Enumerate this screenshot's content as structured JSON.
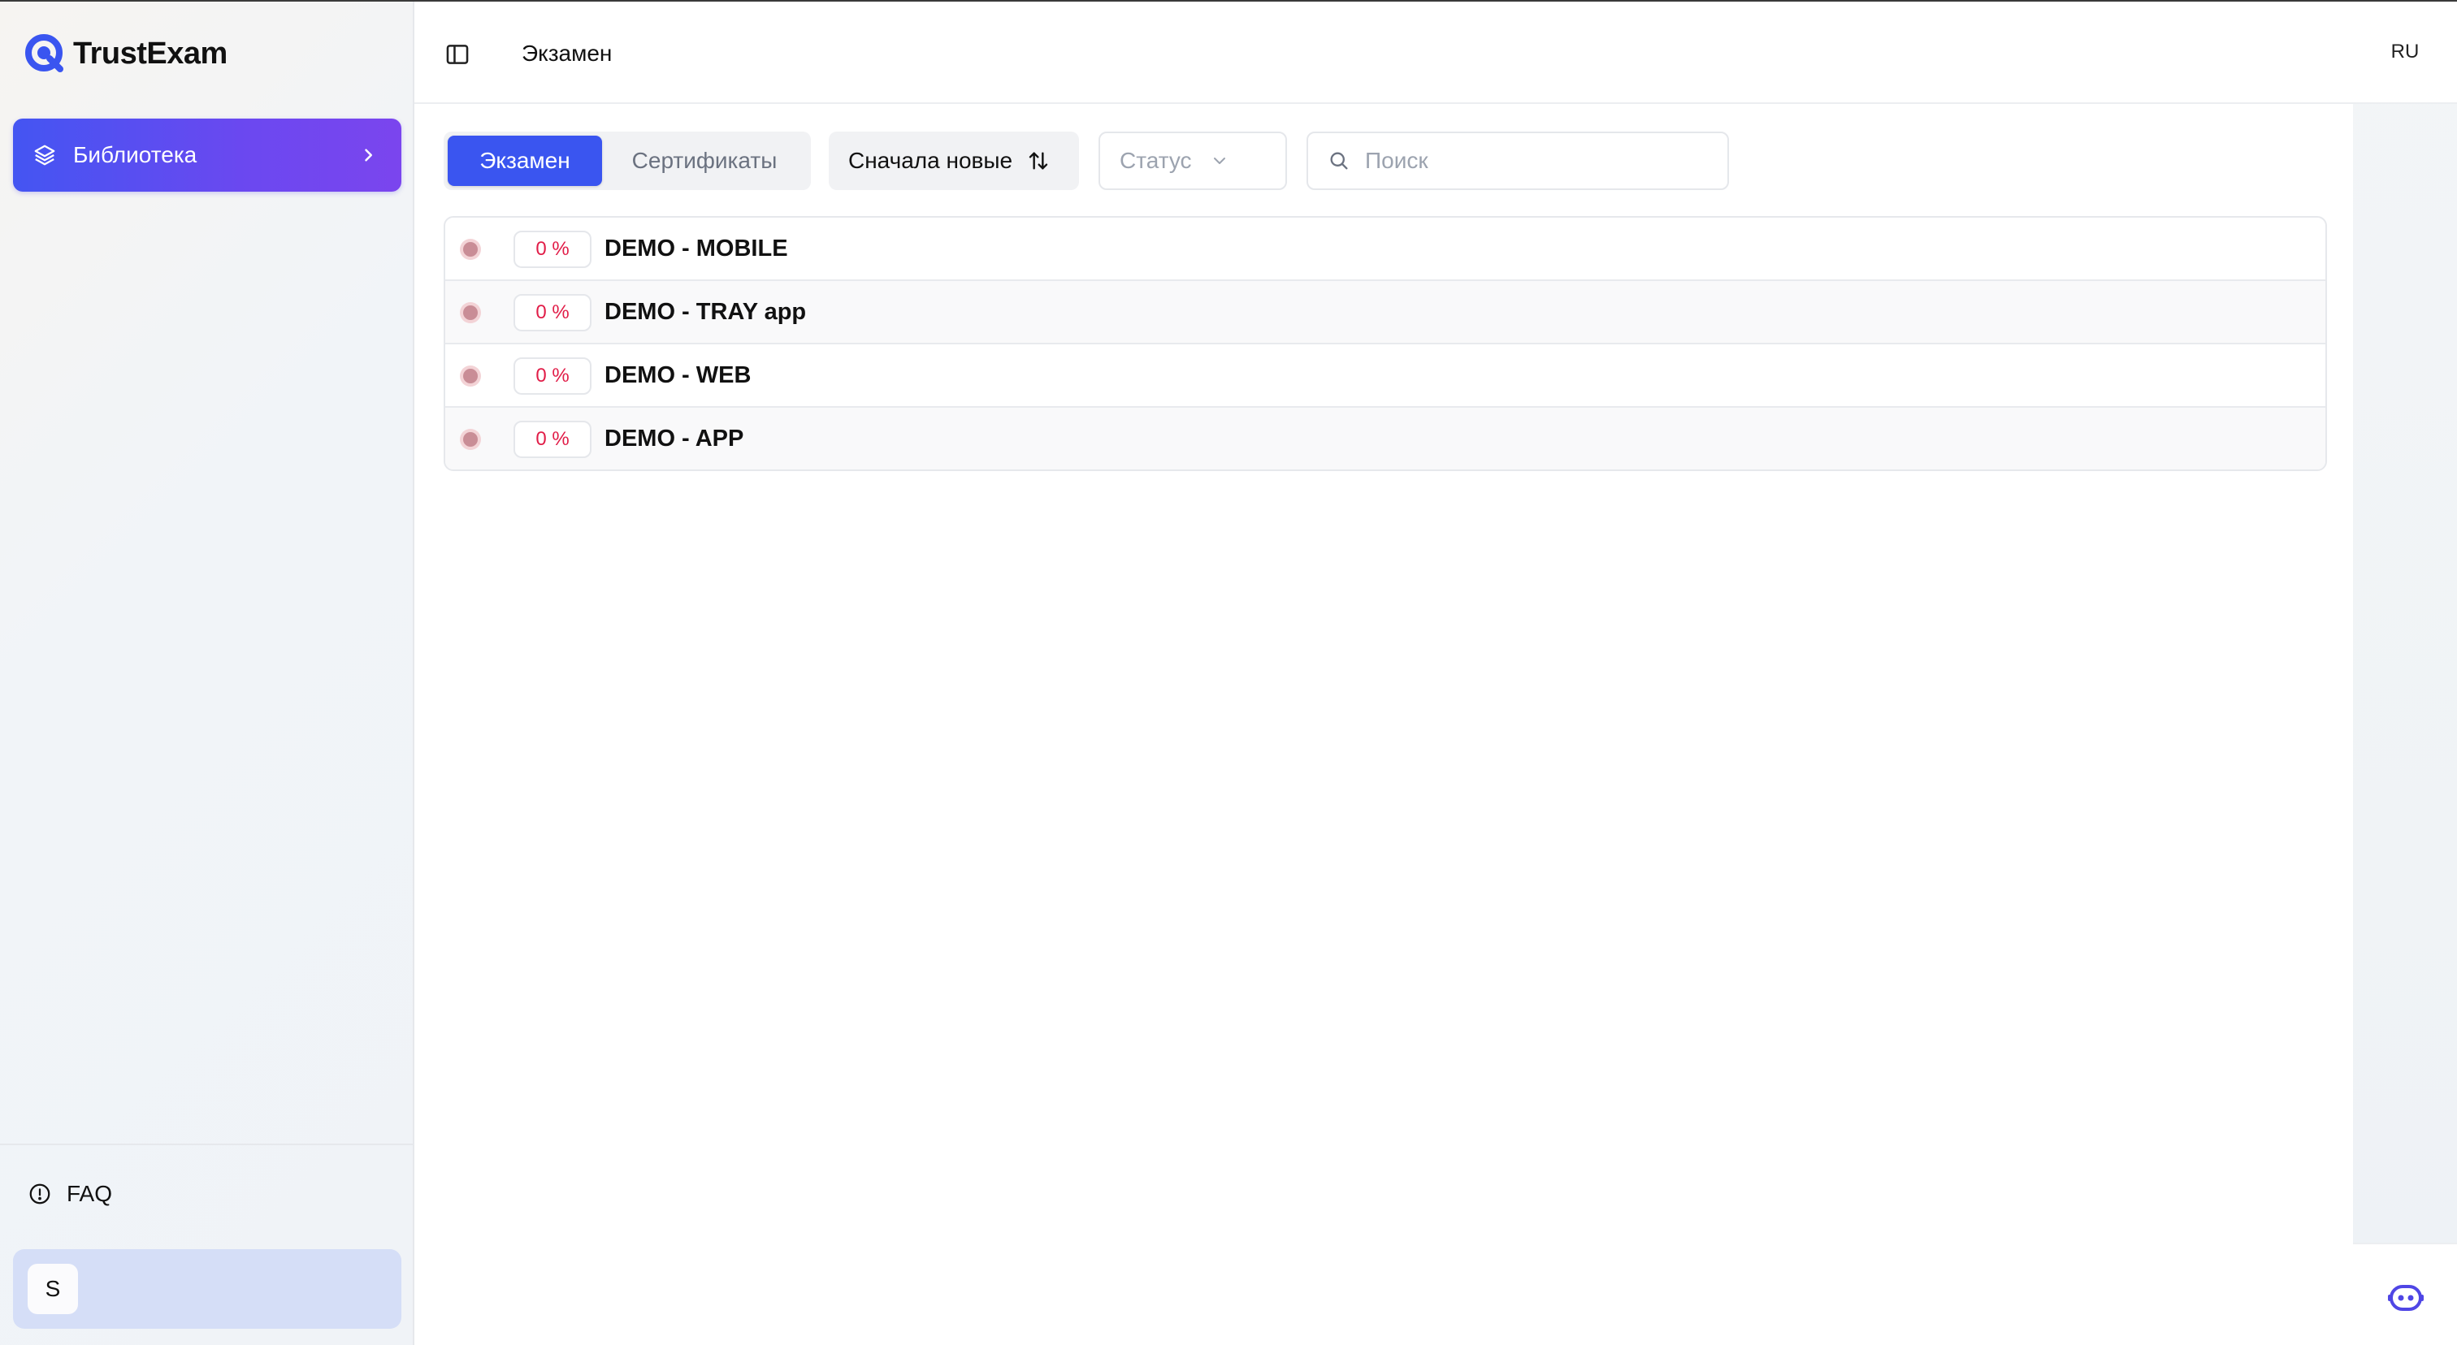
{
  "app": {
    "name": "TrustExam",
    "brand_color": "#3a55f0"
  },
  "sidebar": {
    "nav_items": [
      {
        "label": "Библиотека",
        "icon": "layers-icon",
        "active": true
      }
    ],
    "faq_label": "FAQ",
    "user": {
      "avatar_initial": "S"
    }
  },
  "header": {
    "breadcrumb": "Экзамен"
  },
  "rail": {
    "language": "RU",
    "assistant_icon": "bot-icon"
  },
  "toolbar": {
    "tabs": [
      {
        "label": "Экзамен",
        "active": true
      },
      {
        "label": "Сертификаты",
        "active": false
      }
    ],
    "sort_label": "Сначала новые",
    "status_filter": {
      "placeholder": "Статус"
    },
    "search": {
      "placeholder": "Поиск",
      "value": ""
    }
  },
  "exams": [
    {
      "percent": "0 %",
      "title": "DEMO - MOBILE"
    },
    {
      "percent": "0 %",
      "title": "DEMO - TRAY app"
    },
    {
      "percent": "0 %",
      "title": "DEMO - WEB"
    },
    {
      "percent": "0 %",
      "title": "DEMO - APP"
    }
  ]
}
